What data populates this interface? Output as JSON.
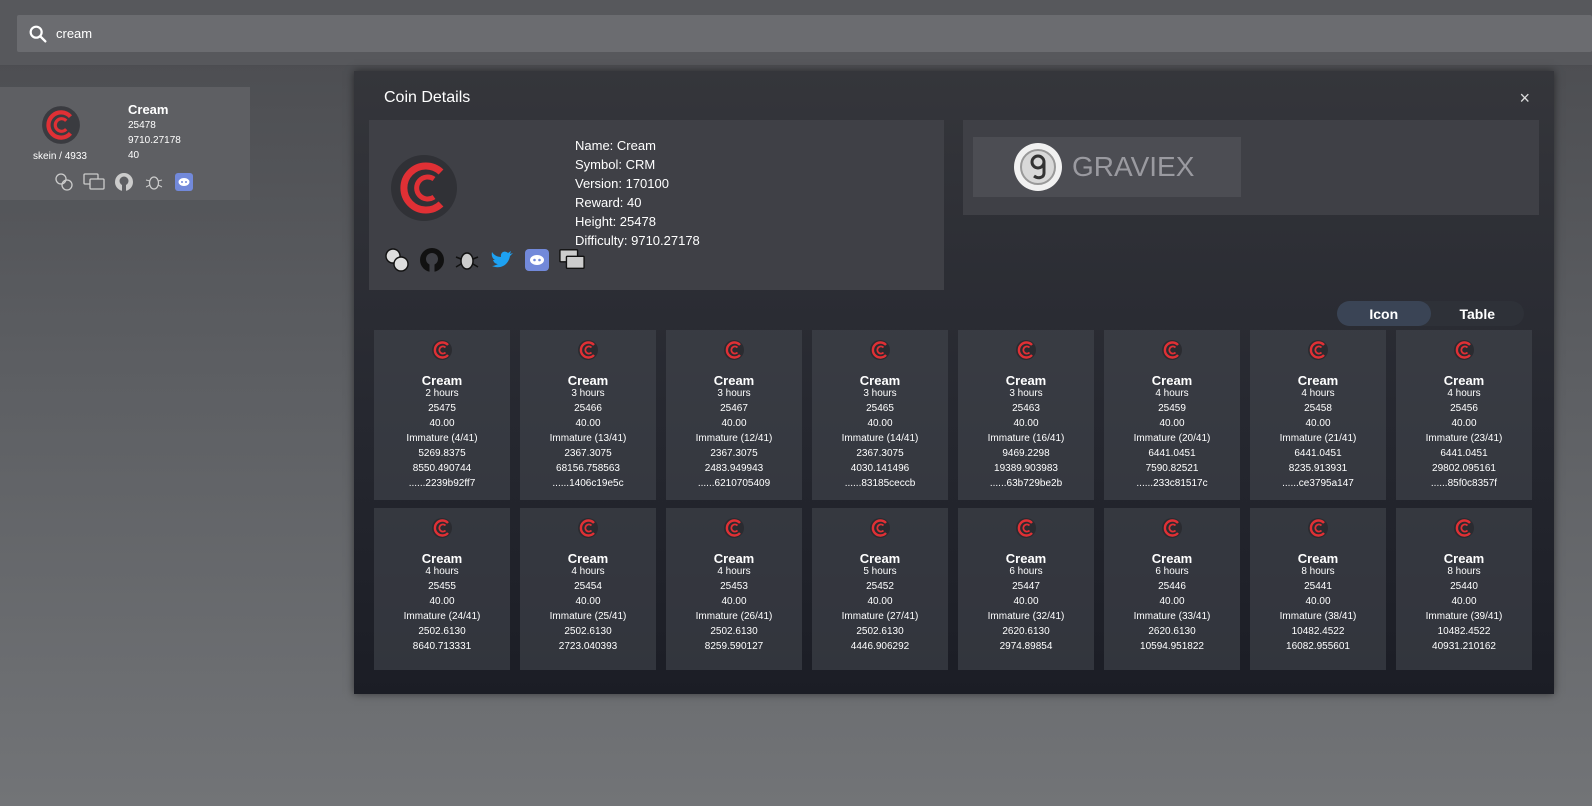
{
  "search": {
    "value": "cream"
  },
  "coin_card": {
    "name": "Cream",
    "height": "25478",
    "difficulty": "9710.27178",
    "reward": "40",
    "algo": "skein / 4933"
  },
  "modal": {
    "title": "Coin Details",
    "close": "×",
    "info": {
      "name": "Name: Cream",
      "symbol": "Symbol: CRM",
      "version": "Version: 170100",
      "reward": "Reward: 40",
      "height": "Height: 25478",
      "difficulty": "Difficulty: 9710.27178"
    },
    "exchange": {
      "name": "GRAVIEX"
    },
    "toggle": {
      "icon": "Icon",
      "table": "Table"
    }
  },
  "blocks": [
    {
      "name": "Cream",
      "age": "2 hours",
      "height": "25475",
      "reward": "40.00",
      "status": "Immature (4/41)",
      "diff": "5269.8375",
      "shares": "8550.490744",
      "hash": "......2239b92ff7"
    },
    {
      "name": "Cream",
      "age": "3 hours",
      "height": "25466",
      "reward": "40.00",
      "status": "Immature (13/41)",
      "diff": "2367.3075",
      "shares": "68156.758563",
      "hash": "......1406c19e5c"
    },
    {
      "name": "Cream",
      "age": "3 hours",
      "height": "25467",
      "reward": "40.00",
      "status": "Immature (12/41)",
      "diff": "2367.3075",
      "shares": "2483.949943",
      "hash": "......6210705409"
    },
    {
      "name": "Cream",
      "age": "3 hours",
      "height": "25465",
      "reward": "40.00",
      "status": "Immature (14/41)",
      "diff": "2367.3075",
      "shares": "4030.141496",
      "hash": "......83185ceccb"
    },
    {
      "name": "Cream",
      "age": "3 hours",
      "height": "25463",
      "reward": "40.00",
      "status": "Immature (16/41)",
      "diff": "9469.2298",
      "shares": "19389.903983",
      "hash": "......63b729be2b"
    },
    {
      "name": "Cream",
      "age": "4 hours",
      "height": "25459",
      "reward": "40.00",
      "status": "Immature (20/41)",
      "diff": "6441.0451",
      "shares": "7590.82521",
      "hash": "......233c81517c"
    },
    {
      "name": "Cream",
      "age": "4 hours",
      "height": "25458",
      "reward": "40.00",
      "status": "Immature (21/41)",
      "diff": "6441.0451",
      "shares": "8235.913931",
      "hash": "......ce3795a147"
    },
    {
      "name": "Cream",
      "age": "4 hours",
      "height": "25456",
      "reward": "40.00",
      "status": "Immature (23/41)",
      "diff": "6441.0451",
      "shares": "29802.095161",
      "hash": "......85f0c8357f"
    },
    {
      "name": "Cream",
      "age": "4 hours",
      "height": "25455",
      "reward": "40.00",
      "status": "Immature (24/41)",
      "diff": "2502.6130",
      "shares": "8640.713331",
      "hash": ""
    },
    {
      "name": "Cream",
      "age": "4 hours",
      "height": "25454",
      "reward": "40.00",
      "status": "Immature (25/41)",
      "diff": "2502.6130",
      "shares": "2723.040393",
      "hash": ""
    },
    {
      "name": "Cream",
      "age": "4 hours",
      "height": "25453",
      "reward": "40.00",
      "status": "Immature (26/41)",
      "diff": "2502.6130",
      "shares": "8259.590127",
      "hash": ""
    },
    {
      "name": "Cream",
      "age": "5 hours",
      "height": "25452",
      "reward": "40.00",
      "status": "Immature (27/41)",
      "diff": "2502.6130",
      "shares": "4446.906292",
      "hash": ""
    },
    {
      "name": "Cream",
      "age": "6 hours",
      "height": "25447",
      "reward": "40.00",
      "status": "Immature (32/41)",
      "diff": "2620.6130",
      "shares": "2974.89854",
      "hash": ""
    },
    {
      "name": "Cream",
      "age": "6 hours",
      "height": "25446",
      "reward": "40.00",
      "status": "Immature (33/41)",
      "diff": "2620.6130",
      "shares": "10594.951822",
      "hash": ""
    },
    {
      "name": "Cream",
      "age": "8 hours",
      "height": "25441",
      "reward": "40.00",
      "status": "Immature (38/41)",
      "diff": "10482.4522",
      "shares": "16082.955601",
      "hash": ""
    },
    {
      "name": "Cream",
      "age": "8 hours",
      "height": "25440",
      "reward": "40.00",
      "status": "Immature (39/41)",
      "diff": "10482.4522",
      "shares": "40931.210162",
      "hash": ""
    }
  ],
  "icons": {
    "coin_logo": "cream-logo-icon",
    "card_icons": [
      "exchange-icon",
      "chat-icon",
      "github-icon",
      "bug-icon",
      "discord-icon"
    ],
    "info_icons": [
      "exchange-icon",
      "github-icon",
      "bug-icon",
      "twitter-icon",
      "discord-icon",
      "chat-icon"
    ]
  },
  "colors": {
    "accent_red": "#e03035",
    "twitter": "#1da1f2",
    "discord": "#7289da"
  }
}
